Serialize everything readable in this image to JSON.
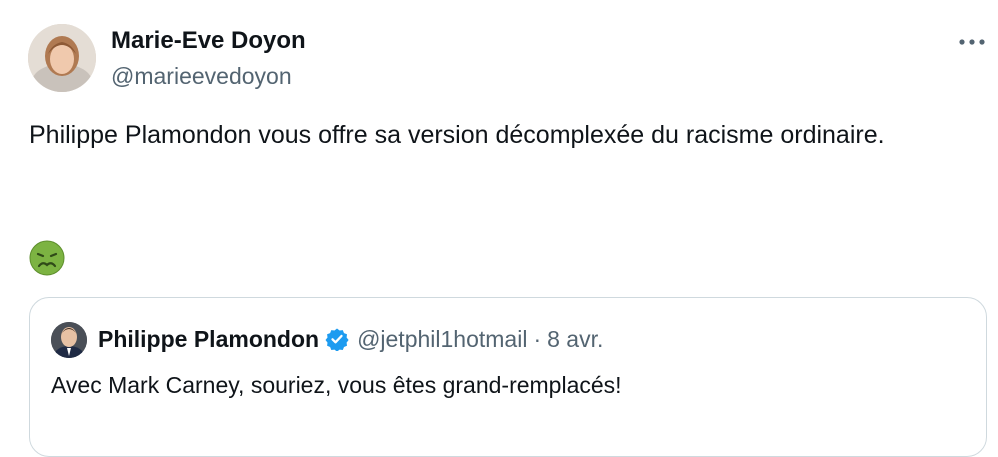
{
  "author": {
    "name": "Marie-Eve Doyon",
    "handle": "@marieevedoyon",
    "avatar_icon": "profile-photo"
  },
  "menu": {
    "icon": "more-horizontal-icon"
  },
  "tweet": {
    "text": "Philippe Plamondon vous offre sa version décomplexée du racisme ordinaire.",
    "emoji": "nauseated-face"
  },
  "quoted_tweet": {
    "author_name": "Philippe Plamondon",
    "verified": true,
    "verified_color": "#1d9bf0",
    "handle": "@jetphil1hotmail",
    "separator": "·",
    "date": "8 avr.",
    "text": "Avec Mark Carney, souriez, vous êtes grand-remplacés!"
  },
  "colors": {
    "text_primary": "#0f1419",
    "text_secondary": "#536471",
    "border": "#cfd9de",
    "emoji_green": "#7cb342"
  }
}
